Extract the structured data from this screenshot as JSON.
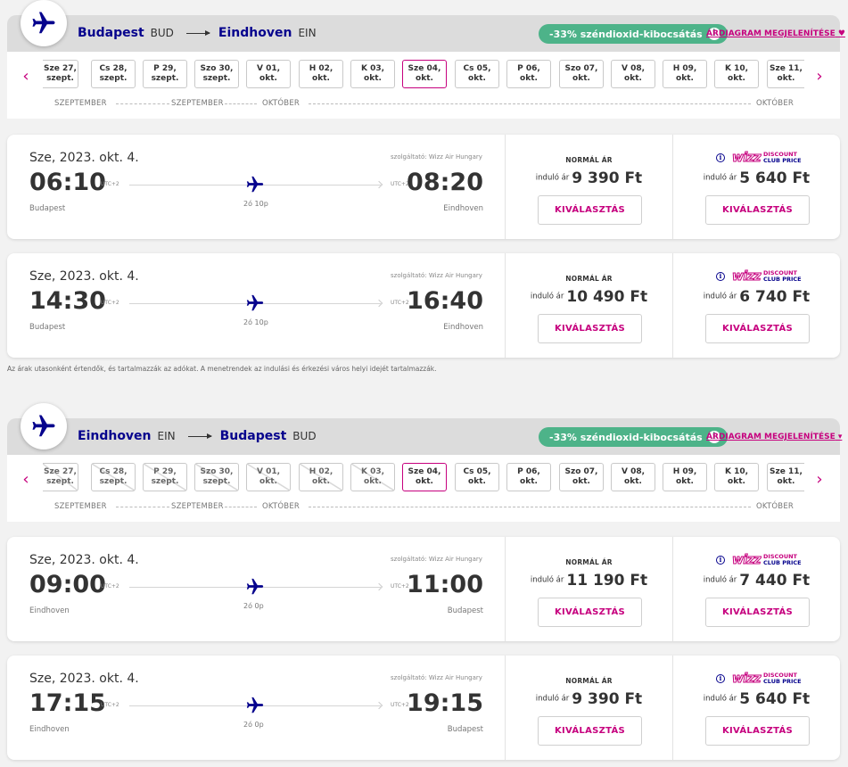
{
  "colors": {
    "brand_navy": "#06038d",
    "brand_magenta": "#c6007e",
    "eco_green": "#4db389"
  },
  "icons": {
    "logo": "airplane-icon",
    "prev": "chevron-left-icon",
    "next": "chevron-right-icon",
    "info": "info-icon"
  },
  "disclaimer": "Az árak utasonként értendők, és tartalmazzák az adókat. A menetrendek az indulási és érkezési város helyi idejét tartalmazzák.",
  "sections": [
    {
      "origin_city": "Budapest",
      "origin_code": "BUD",
      "dest_city": "Eindhoven",
      "dest_code": "EIN",
      "co2_label": "-33% széndioxid-kibocsátás",
      "chart_link": "ÁRDIAGRAM MEGJELENÍTÉSE",
      "dates": [
        {
          "l1": "Sze 27,",
          "l2": "szept.",
          "state": "available"
        },
        {
          "l1": "Cs 28,",
          "l2": "szept.",
          "state": "available"
        },
        {
          "l1": "P 29,",
          "l2": "szept.",
          "state": "available"
        },
        {
          "l1": "Szo 30,",
          "l2": "szept.",
          "state": "available"
        },
        {
          "l1": "V 01,",
          "l2": "okt.",
          "state": "available"
        },
        {
          "l1": "H 02,",
          "l2": "okt.",
          "state": "available"
        },
        {
          "l1": "K 03,",
          "l2": "okt.",
          "state": "available"
        },
        {
          "l1": "Sze 04,",
          "l2": "okt.",
          "state": "selected"
        },
        {
          "l1": "Cs 05,",
          "l2": "okt.",
          "state": "available"
        },
        {
          "l1": "P 06,",
          "l2": "okt.",
          "state": "available"
        },
        {
          "l1": "Szo 07,",
          "l2": "okt.",
          "state": "available"
        },
        {
          "l1": "V 08,",
          "l2": "okt.",
          "state": "available"
        },
        {
          "l1": "H 09,",
          "l2": "okt.",
          "state": "available"
        },
        {
          "l1": "K 10,",
          "l2": "okt.",
          "state": "available"
        },
        {
          "l1": "Sze 11,",
          "l2": "okt.",
          "state": "available"
        }
      ],
      "months": [
        "SZEPTEMBER",
        "SZEPTEMBER",
        "OKTÓBER",
        "OKTÓBER"
      ],
      "flights": [
        {
          "date": "Sze, 2023. okt. 4.",
          "operator": "szolgáltató: Wizz Air Hungary",
          "dep_time": "06:10",
          "arr_time": "08:20",
          "dep_utc": "UTC+2",
          "arr_utc": "UTC+2",
          "duration": "2ó 10p",
          "dep_city": "Budapest",
          "arr_city": "Eindhoven",
          "normal_title": "NORMÁL ÁR",
          "from_label": "induló ár",
          "normal_price": "9 390 Ft",
          "club_wizz": "wizz",
          "club_l1": "DISCOUNT",
          "club_l2": "CLUB PRICE",
          "club_price": "5 640 Ft",
          "select_label": "KIVÁLASZTÁS"
        },
        {
          "date": "Sze, 2023. okt. 4.",
          "operator": "szolgáltató: Wizz Air Hungary",
          "dep_time": "14:30",
          "arr_time": "16:40",
          "dep_utc": "UTC+2",
          "arr_utc": "UTC+2",
          "duration": "2ó 10p",
          "dep_city": "Budapest",
          "arr_city": "Eindhoven",
          "normal_title": "NORMÁL ÁR",
          "from_label": "induló ár",
          "normal_price": "10 490 Ft",
          "club_wizz": "wizz",
          "club_l1": "DISCOUNT",
          "club_l2": "CLUB PRICE",
          "club_price": "6 740 Ft",
          "select_label": "KIVÁLASZTÁS"
        }
      ]
    },
    {
      "origin_city": "Eindhoven",
      "origin_code": "EIN",
      "dest_city": "Budapest",
      "dest_code": "BUD",
      "co2_label": "-33% széndioxid-kibocsátás",
      "chart_link": "ÁRDIAGRAM MEGJELENÍTÉSE",
      "dates": [
        {
          "l1": "Sze 27,",
          "l2": "szept.",
          "state": "disabled"
        },
        {
          "l1": "Cs 28,",
          "l2": "szept.",
          "state": "disabled"
        },
        {
          "l1": "P 29,",
          "l2": "szept.",
          "state": "disabled"
        },
        {
          "l1": "Szo 30,",
          "l2": "szept.",
          "state": "disabled"
        },
        {
          "l1": "V 01,",
          "l2": "okt.",
          "state": "disabled"
        },
        {
          "l1": "H 02,",
          "l2": "okt.",
          "state": "disabled"
        },
        {
          "l1": "K 03,",
          "l2": "okt.",
          "state": "disabled"
        },
        {
          "l1": "Sze 04,",
          "l2": "okt.",
          "state": "selected"
        },
        {
          "l1": "Cs 05,",
          "l2": "okt.",
          "state": "available"
        },
        {
          "l1": "P 06,",
          "l2": "okt.",
          "state": "available"
        },
        {
          "l1": "Szo 07,",
          "l2": "okt.",
          "state": "available"
        },
        {
          "l1": "V 08,",
          "l2": "okt.",
          "state": "available"
        },
        {
          "l1": "H 09,",
          "l2": "okt.",
          "state": "available"
        },
        {
          "l1": "K 10,",
          "l2": "okt.",
          "state": "available"
        },
        {
          "l1": "Sze 11,",
          "l2": "okt.",
          "state": "available"
        }
      ],
      "months": [
        "SZEPTEMBER",
        "SZEPTEMBER",
        "OKTÓBER",
        "OKTÓBER"
      ],
      "flights": [
        {
          "date": "Sze, 2023. okt. 4.",
          "operator": "szolgáltató: Wizz Air Hungary",
          "dep_time": "09:00",
          "arr_time": "11:00",
          "dep_utc": "UTC+2",
          "arr_utc": "UTC+2",
          "duration": "2ó 0p",
          "dep_city": "Eindhoven",
          "arr_city": "Budapest",
          "normal_title": "NORMÁL ÁR",
          "from_label": "induló ár",
          "normal_price": "11 190 Ft",
          "club_wizz": "wizz",
          "club_l1": "DISCOUNT",
          "club_l2": "CLUB PRICE",
          "club_price": "7 440 Ft",
          "select_label": "KIVÁLASZTÁS"
        },
        {
          "date": "Sze, 2023. okt. 4.",
          "operator": "szolgáltató: Wizz Air Hungary",
          "dep_time": "17:15",
          "arr_time": "19:15",
          "dep_utc": "UTC+2",
          "arr_utc": "UTC+2",
          "duration": "2ó 0p",
          "dep_city": "Eindhoven",
          "arr_city": "Budapest",
          "normal_title": "NORMÁL ÁR",
          "from_label": "induló ár",
          "normal_price": "9 390 Ft",
          "club_wizz": "wizz",
          "club_l1": "DISCOUNT",
          "club_l2": "CLUB PRICE",
          "club_price": "5 640 Ft",
          "select_label": "KIVÁLASZTÁS"
        }
      ]
    }
  ]
}
